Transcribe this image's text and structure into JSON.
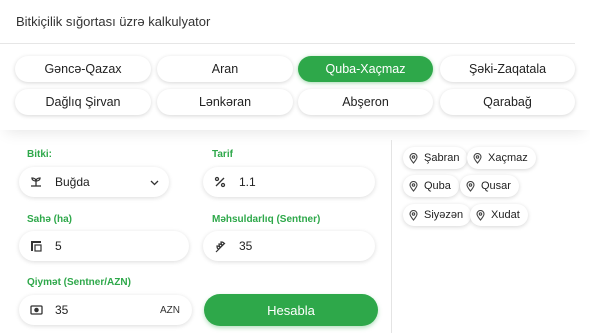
{
  "title": "Bitkiçilik sığortası üzrə kalkulyator",
  "regions": [
    "Gəncə-Qazax",
    "Aran",
    "Quba-Xaçmaz",
    "Şəki-Zaqatala",
    "Dağlıq Şirvan",
    "Lənkəran",
    "Abşeron",
    "Qarabağ"
  ],
  "active_region": "Quba-Xaçmaz",
  "form": {
    "crop_label": "Bitki:",
    "crop_value": "Buğda",
    "tariff_label": "Tarif",
    "tariff_value": "1.1",
    "area_label": "Sahə (ha)",
    "area_value": "5",
    "yield_label": "Məhsuldarlıq (Sentner)",
    "yield_value": "35",
    "price_label": "Qiymət (Sentner/AZN)",
    "price_value": "35",
    "price_unit": "AZN",
    "calculate_label": "Hesabla"
  },
  "districts": [
    "Şabran",
    "Xaçmaz",
    "Quba",
    "Qusar",
    "Siyəzən",
    "Xudat"
  ],
  "colors": {
    "accent": "#2ea84a"
  },
  "icons": {
    "crop": "plant-icon",
    "tariff": "percent-icon",
    "area": "area-icon",
    "yield": "wheat-icon",
    "price": "money-icon",
    "district": "location-pin-icon"
  }
}
